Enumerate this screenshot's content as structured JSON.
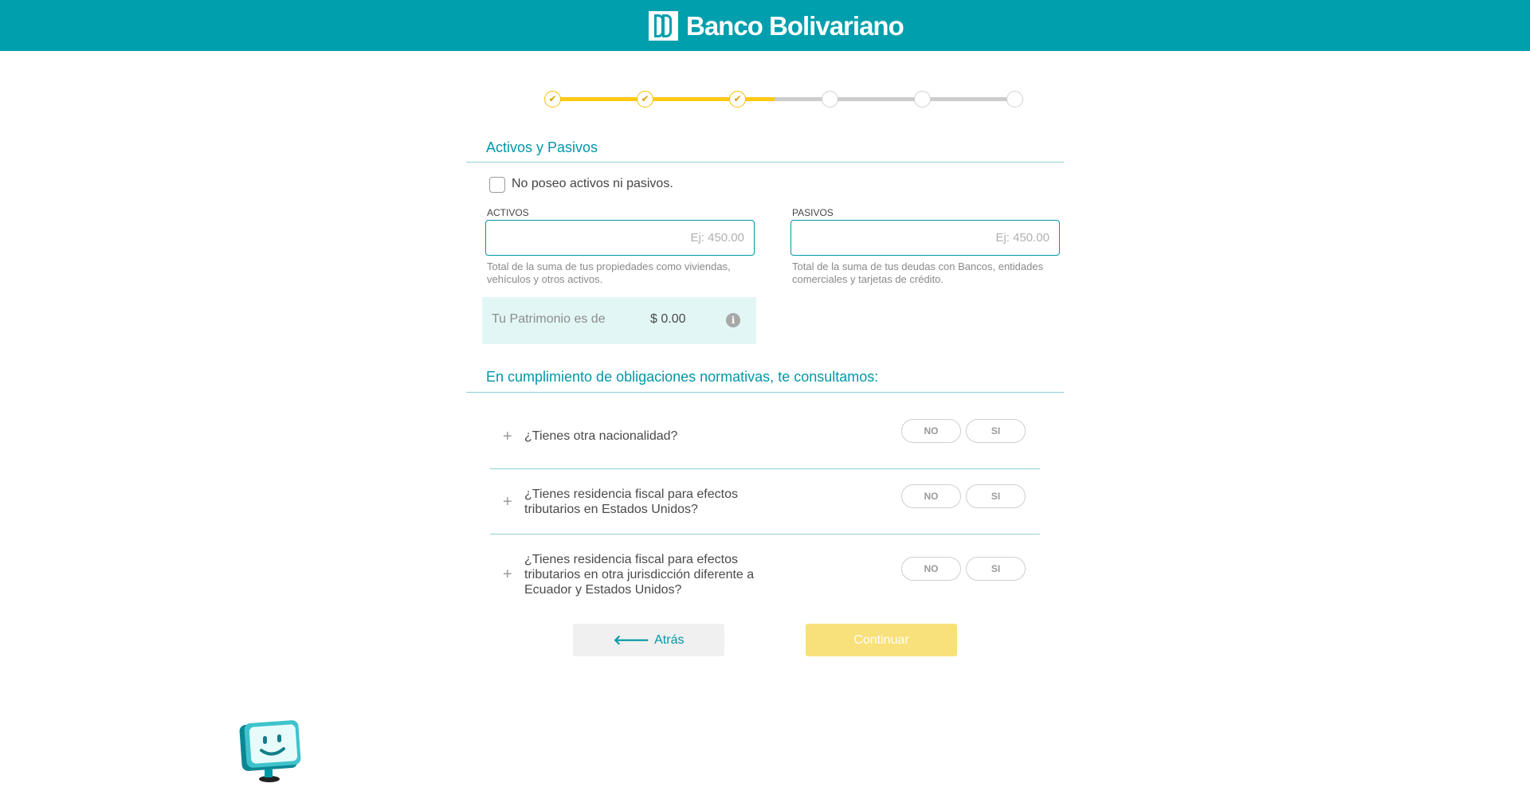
{
  "header": {
    "brand_name": "Banco Bolivariano",
    "brand_color": "#009fad"
  },
  "stepper": {
    "total_steps": 6,
    "completed_steps": 3,
    "check_glyph": "✔"
  },
  "assets_section": {
    "title": "Activos y Pasivos",
    "no_assets_label": "No poseo activos ni pasivos.",
    "no_assets_checked": false,
    "activos": {
      "label": "ACTIVOS",
      "placeholder": "Ej: 450.00",
      "value": "",
      "help": "Total de la suma de tus propiedades como viviendas, vehículos y otros activos."
    },
    "pasivos": {
      "label": "PASIVOS",
      "placeholder": "Ej: 450.00",
      "value": "",
      "help": "Total de la suma de tus deudas con Bancos, entidades comerciales y tarjetas de crédito."
    },
    "patrimonio": {
      "label": "Tu Patrimonio es de",
      "value": "$ 0.00",
      "info_icon": "i"
    }
  },
  "compliance_section": {
    "title": "En cumplimiento de obligaciones normativas, te consultamos:",
    "questions": [
      {
        "text": "¿Tienes otra nacionalidad?",
        "no_label": "NO",
        "yes_label": "SI",
        "expand_icon": "+"
      },
      {
        "text": "¿Tienes residencia fiscal para efectos tributarios en Estados Unidos?",
        "no_label": "NO",
        "yes_label": "SI",
        "expand_icon": "+"
      },
      {
        "text": "¿Tienes residencia fiscal para efectos tributarios en otra jurisdicción diferente a Ecuador y Estados Unidos?",
        "no_label": "NO",
        "yes_label": "SI",
        "expand_icon": "+"
      }
    ]
  },
  "actions": {
    "back_label": "Atrás",
    "back_icon": "🡐",
    "continue_label": "Continuar"
  },
  "colors": {
    "accent": "#0097a7",
    "progress": "#ffc914",
    "continue_disabled": "#f8e07a"
  }
}
